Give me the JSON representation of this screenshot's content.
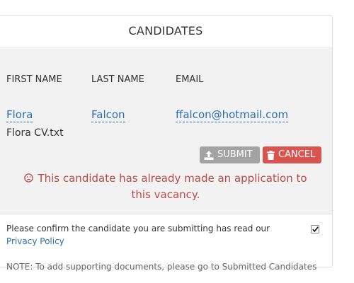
{
  "panel": {
    "title": "CANDIDATES"
  },
  "table": {
    "headers": [
      "FIRST NAME",
      "LAST NAME",
      "EMAIL"
    ],
    "row": {
      "first_name": "Flora",
      "last_name": "Falcon",
      "email": "ffalcon@hotmail.com"
    },
    "file_name": "Flora CV.txt"
  },
  "buttons": {
    "submit_label": "SUBMIT",
    "cancel_label": "CANCEL",
    "submit_icon": "upload-icon",
    "cancel_icon": "trash-icon"
  },
  "alert": {
    "icon": "frown-icon",
    "message": "This candidate has already made an application to this vacancy."
  },
  "confirm": {
    "text": "Please confirm the candidate you are submitting has read our",
    "link_label": "Privacy Policy",
    "checked": true
  },
  "note": "NOTE: To add supporting documents, please go to Submitted Candidates",
  "colors": {
    "link": "#2a6fb0",
    "danger": "#d9534f",
    "alert_text": "#b94a48",
    "submit_bg": "#a3a3a3"
  }
}
